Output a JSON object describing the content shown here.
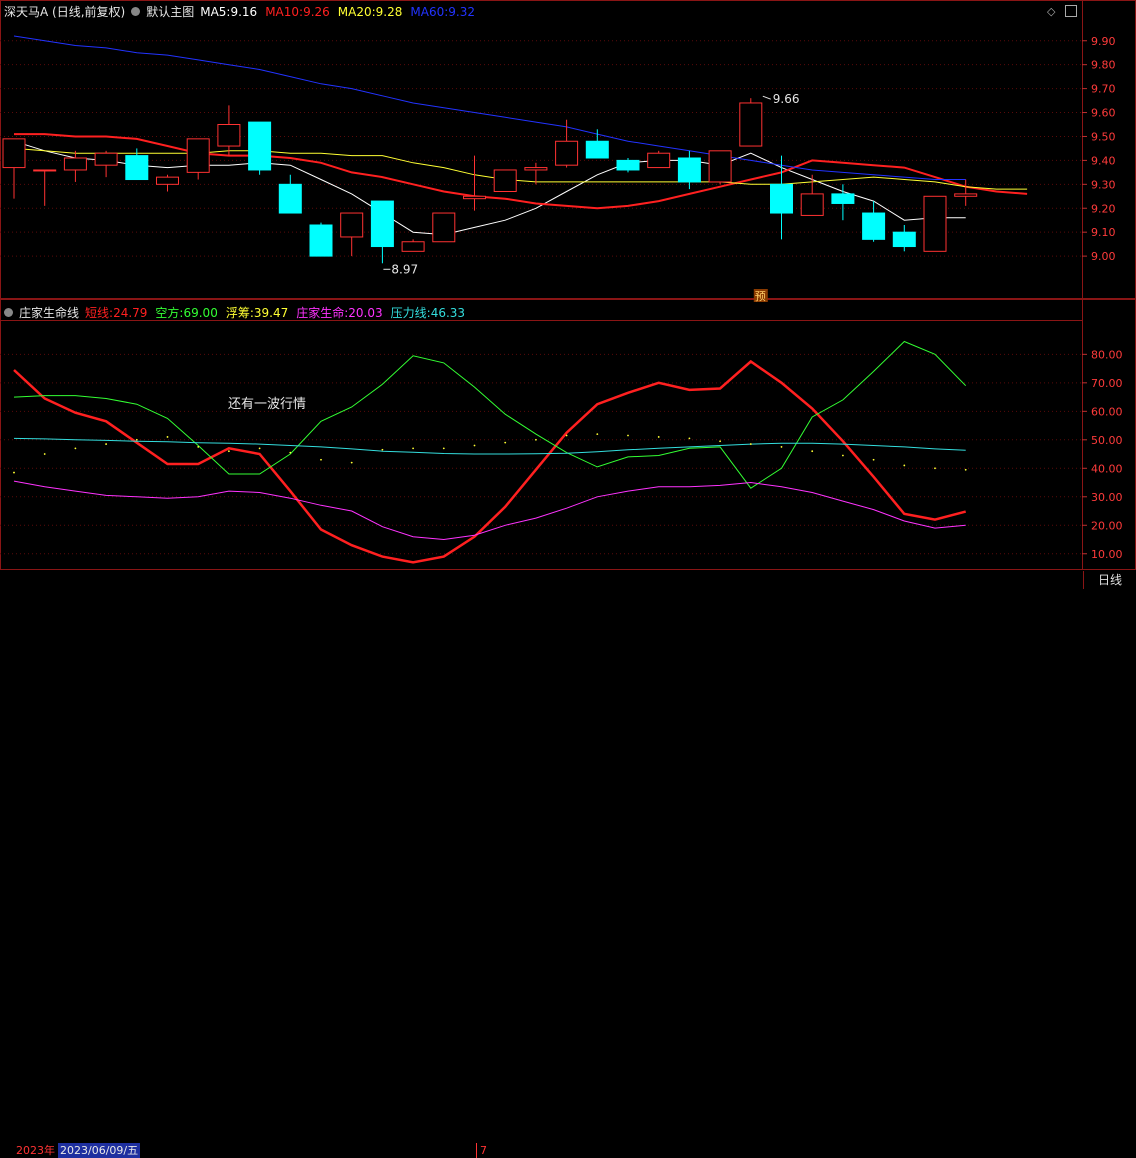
{
  "header": {
    "stock_name": "深天马A (日线,前复权)",
    "main_chart_label": "默认主图",
    "ma": [
      {
        "label": "MA5:",
        "value": "9.16",
        "color": "#ffffff"
      },
      {
        "label": "MA10:",
        "value": "9.26",
        "color": "#ff2020"
      },
      {
        "label": "MA20:",
        "value": "9.28",
        "color": "#ffff33"
      },
      {
        "label": "MA60:",
        "value": "9.32",
        "color": "#2233ff"
      }
    ]
  },
  "sub_header": {
    "indicator_name": "庄家生命线",
    "lines": [
      {
        "label": "短线:",
        "value": "24.79",
        "color": "#ff2020"
      },
      {
        "label": "空方:",
        "value": "69.00",
        "color": "#33ff33"
      },
      {
        "label": "浮筹:",
        "value": "39.47",
        "color": "#ffff33"
      },
      {
        "label": "庄家生命:",
        "value": "20.03",
        "color": "#ff33ff"
      },
      {
        "label": "压力线:",
        "value": "46.33",
        "color": "#33dddd"
      }
    ]
  },
  "annotations": {
    "max_label": "9.66",
    "min_label": "8.97",
    "forecast_badge": "预",
    "note_text": "还有一波行情"
  },
  "x_axis": {
    "year_label": "2023年",
    "date_label": "2023/06/09/五",
    "month_label": "7"
  },
  "period_button": "日线",
  "chart_data": [
    {
      "type": "candlestick",
      "ylim": [
        8.85,
        9.97
      ],
      "y_ticks": [
        "9.90",
        "9.80",
        "9.70",
        "9.60",
        "9.50",
        "9.40",
        "9.30",
        "9.20",
        "9.10",
        "9.00"
      ],
      "candles": [
        {
          "o": 9.37,
          "h": 9.49,
          "l": 9.24,
          "c": 9.49
        },
        {
          "o": 9.36,
          "h": 9.36,
          "l": 9.21,
          "c": 9.36
        },
        {
          "o": 9.36,
          "h": 9.44,
          "l": 9.31,
          "c": 9.41
        },
        {
          "o": 9.38,
          "h": 9.44,
          "l": 9.33,
          "c": 9.43
        },
        {
          "o": 9.42,
          "h": 9.45,
          "l": 9.32,
          "c": 9.32
        },
        {
          "o": 9.3,
          "h": 9.34,
          "l": 9.27,
          "c": 9.33
        },
        {
          "o": 9.35,
          "h": 9.49,
          "l": 9.32,
          "c": 9.49
        },
        {
          "o": 9.46,
          "h": 9.63,
          "l": 9.42,
          "c": 9.55
        },
        {
          "o": 9.56,
          "h": 9.56,
          "l": 9.34,
          "c": 9.36
        },
        {
          "o": 9.3,
          "h": 9.34,
          "l": 9.18,
          "c": 9.18
        },
        {
          "o": 9.13,
          "h": 9.14,
          "l": 9.0,
          "c": 9.0
        },
        {
          "o": 9.08,
          "h": 9.17,
          "l": 9.0,
          "c": 9.18
        },
        {
          "o": 9.23,
          "h": 9.23,
          "l": 8.97,
          "c": 9.04
        },
        {
          "o": 9.02,
          "h": 9.07,
          "l": 9.02,
          "c": 9.06
        },
        {
          "o": 9.06,
          "h": 9.18,
          "l": 9.06,
          "c": 9.18
        },
        {
          "o": 9.24,
          "h": 9.42,
          "l": 9.19,
          "c": 9.25
        },
        {
          "o": 9.27,
          "h": 9.36,
          "l": 9.27,
          "c": 9.36
        },
        {
          "o": 9.36,
          "h": 9.39,
          "l": 9.3,
          "c": 9.37
        },
        {
          "o": 9.38,
          "h": 9.57,
          "l": 9.37,
          "c": 9.48
        },
        {
          "o": 9.48,
          "h": 9.53,
          "l": 9.41,
          "c": 9.41
        },
        {
          "o": 9.4,
          "h": 9.41,
          "l": 9.35,
          "c": 9.36
        },
        {
          "o": 9.37,
          "h": 9.44,
          "l": 9.37,
          "c": 9.43
        },
        {
          "o": 9.41,
          "h": 9.44,
          "l": 9.28,
          "c": 9.31
        },
        {
          "o": 9.31,
          "h": 9.44,
          "l": 9.3,
          "c": 9.44
        },
        {
          "o": 9.46,
          "h": 9.66,
          "l": 9.46,
          "c": 9.64
        },
        {
          "o": 9.3,
          "h": 9.42,
          "l": 9.07,
          "c": 9.18
        },
        {
          "o": 9.17,
          "h": 9.34,
          "l": 9.17,
          "c": 9.26
        },
        {
          "o": 9.26,
          "h": 9.3,
          "l": 9.15,
          "c": 9.22
        },
        {
          "o": 9.18,
          "h": 9.23,
          "l": 9.06,
          "c": 9.07
        },
        {
          "o": 9.1,
          "h": 9.13,
          "l": 9.02,
          "c": 9.04
        },
        {
          "o": 9.02,
          "h": 9.25,
          "l": 9.02,
          "c": 9.25
        },
        {
          "o": 9.25,
          "h": 9.32,
          "l": 9.21,
          "c": 9.26
        }
      ],
      "ma_series": [
        {
          "name": "MA5",
          "color": "#ffffff",
          "values": [
            9.48,
            9.44,
            9.41,
            9.4,
            9.38,
            9.37,
            9.38,
            9.38,
            9.39,
            9.38,
            9.32,
            9.26,
            9.18,
            9.1,
            9.09,
            9.12,
            9.15,
            9.2,
            9.27,
            9.34,
            9.39,
            9.4,
            9.4,
            9.38,
            9.43,
            9.37,
            9.32,
            9.27,
            9.23,
            9.15,
            9.16,
            9.16
          ]
        },
        {
          "name": "MA10",
          "color": "#ff2020",
          "values": [
            9.51,
            9.51,
            9.5,
            9.5,
            9.49,
            9.46,
            9.43,
            9.42,
            9.42,
            9.41,
            9.39,
            9.35,
            9.33,
            9.3,
            9.27,
            9.25,
            9.24,
            9.22,
            9.21,
            9.2,
            9.21,
            9.23,
            9.26,
            9.29,
            9.32,
            9.35,
            9.4,
            9.39,
            9.38,
            9.37,
            9.33,
            9.29,
            9.27,
            9.26
          ]
        },
        {
          "name": "MA20",
          "color": "#ffff33",
          "values": [
            9.45,
            9.44,
            9.43,
            9.43,
            9.43,
            9.43,
            9.43,
            9.44,
            9.44,
            9.43,
            9.43,
            9.42,
            9.42,
            9.39,
            9.37,
            9.34,
            9.32,
            9.31,
            9.31,
            9.31,
            9.31,
            9.31,
            9.31,
            9.31,
            9.3,
            9.3,
            9.31,
            9.32,
            9.33,
            9.32,
            9.31,
            9.29,
            9.28,
            9.28
          ]
        },
        {
          "name": "MA60",
          "color": "#2233ff",
          "values": [
            9.92,
            9.9,
            9.88,
            9.87,
            9.85,
            9.84,
            9.82,
            9.8,
            9.78,
            9.75,
            9.72,
            9.7,
            9.67,
            9.64,
            9.62,
            9.6,
            9.58,
            9.56,
            9.54,
            9.51,
            9.48,
            9.46,
            9.44,
            9.42,
            9.4,
            9.38,
            9.36,
            9.35,
            9.34,
            9.33,
            9.32,
            9.32
          ]
        }
      ]
    },
    {
      "type": "line",
      "ylim": [
        5,
        91
      ],
      "y_ticks": [
        "80.00",
        "70.00",
        "60.00",
        "50.00",
        "40.00",
        "30.00",
        "20.00",
        "10.00"
      ],
      "series": [
        {
          "name": "短线",
          "color": "#ff2020",
          "width": 2.5,
          "values": [
            74.5,
            64.5,
            59.5,
            56.5,
            49.0,
            41.5,
            41.5,
            47.0,
            45.0,
            32.0,
            18.5,
            13.0,
            9.0,
            7.0,
            9.0,
            16.0,
            26.5,
            39.5,
            52.5,
            62.5,
            66.5,
            70.0,
            67.5,
            68.0,
            77.5,
            70.0,
            61.0,
            49.5,
            37.0,
            24.0,
            22.0,
            24.79
          ]
        },
        {
          "name": "空方",
          "color": "#33ff33",
          "width": 1,
          "values": [
            65.0,
            65.5,
            65.5,
            64.5,
            62.5,
            57.5,
            48.0,
            38.0,
            38.0,
            45.0,
            56.5,
            61.5,
            69.5,
            79.5,
            77.0,
            68.5,
            59.0,
            52.0,
            45.5,
            40.5,
            44.0,
            44.5,
            47.0,
            47.5,
            33.0,
            40.0,
            58.0,
            64.0,
            74.0,
            84.5,
            80.0,
            69.0
          ]
        },
        {
          "name": "庄家生命",
          "color": "#ff33ff",
          "width": 1,
          "values": [
            35.5,
            33.5,
            32.0,
            30.5,
            30.0,
            29.5,
            30.0,
            32.0,
            31.5,
            29.5,
            27.0,
            25.0,
            19.5,
            16.0,
            15.0,
            16.5,
            20.0,
            22.5,
            26.0,
            30.0,
            32.0,
            33.5,
            33.5,
            34.0,
            35.0,
            33.5,
            31.5,
            28.5,
            25.5,
            21.5,
            19.0,
            20.03
          ]
        },
        {
          "name": "压力线",
          "color": "#33dddd",
          "width": 1,
          "values": [
            50.5,
            50.3,
            50.0,
            49.8,
            49.5,
            49.3,
            49.0,
            48.8,
            48.5,
            48.0,
            47.5,
            46.8,
            46.0,
            45.6,
            45.2,
            45.0,
            45.0,
            45.1,
            45.3,
            45.8,
            46.5,
            47.0,
            47.5,
            48.0,
            48.5,
            48.8,
            48.8,
            48.5,
            48.0,
            47.5,
            46.8,
            46.33
          ]
        },
        {
          "name": "浮筹",
          "color": "#ffff33",
          "values": [
            38.5,
            45.0,
            47.0,
            48.5,
            50.0,
            51.0,
            47.5,
            46.0,
            47.0,
            45.5,
            43.0,
            42.0,
            46.5,
            47.0,
            47.0,
            48.0,
            49.0,
            50.0,
            51.5,
            52.0,
            51.5,
            51.0,
            50.5,
            49.5,
            48.5,
            47.5,
            46.0,
            44.5,
            43.0,
            41.0,
            40.0,
            39.47
          ]
        }
      ]
    }
  ]
}
